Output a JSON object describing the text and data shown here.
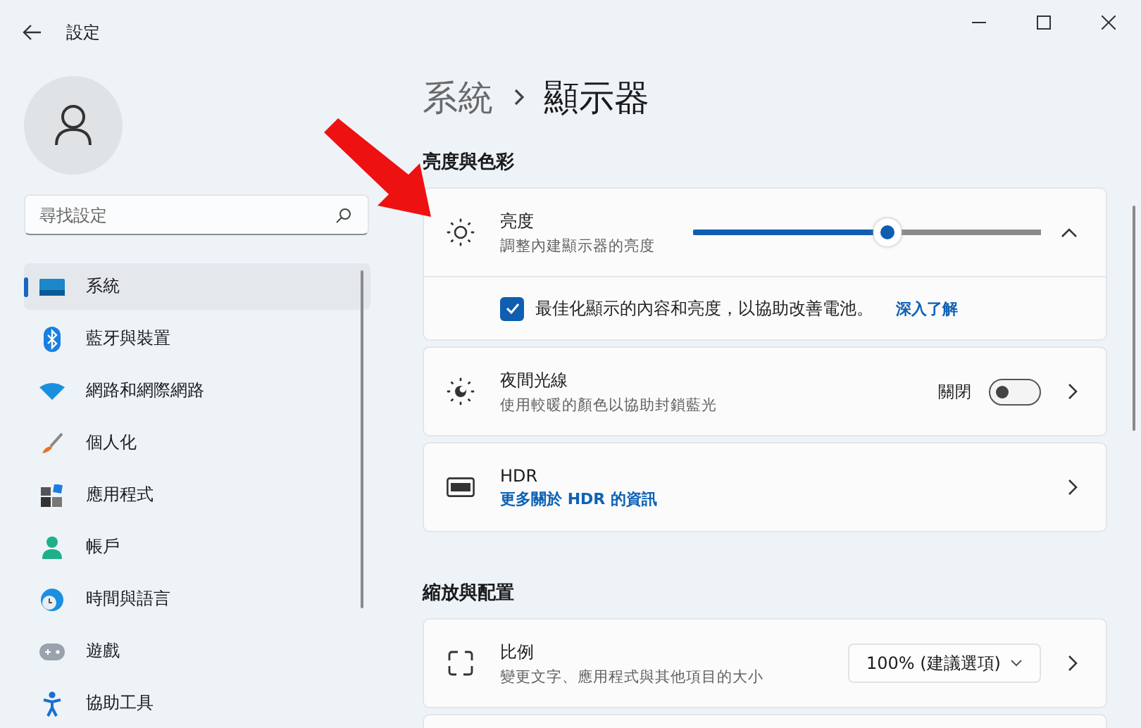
{
  "window": {
    "title": "設定"
  },
  "search": {
    "placeholder": "尋找設定"
  },
  "sidebar": {
    "items": [
      {
        "label": "系統",
        "selected": true
      },
      {
        "label": "藍牙與裝置",
        "selected": false
      },
      {
        "label": "網路和網際網路",
        "selected": false
      },
      {
        "label": "個人化",
        "selected": false
      },
      {
        "label": "應用程式",
        "selected": false
      },
      {
        "label": "帳戶",
        "selected": false
      },
      {
        "label": "時間與語言",
        "selected": false
      },
      {
        "label": "遊戲",
        "selected": false
      },
      {
        "label": "協助工具",
        "selected": false
      }
    ]
  },
  "breadcrumb": {
    "parent": "系統",
    "current": "顯示器"
  },
  "sections": [
    {
      "heading": "亮度與色彩",
      "cards": [
        {
          "kind": "slider",
          "title": "亮度",
          "subtitle": "調整內建顯示器的亮度",
          "level": 0.56,
          "expanded": true,
          "option": {
            "label": "最佳化顯示的內容和亮度，以協助改善電池。",
            "link": "深入了解",
            "checked": true
          }
        },
        {
          "kind": "toggle",
          "title": "夜間光線",
          "subtitle": "使用較暖的顏色以協助封鎖藍光",
          "state_label": "關閉",
          "on": false
        },
        {
          "kind": "link",
          "title": "HDR",
          "link": "更多關於 HDR 的資訊"
        }
      ]
    },
    {
      "heading": "縮放與配置",
      "cards": [
        {
          "kind": "dropdown",
          "title": "比例",
          "subtitle": "變更文字、應用程式與其他項目的大小",
          "value": "100% (建議選項)"
        },
        {
          "kind": "cut"
        }
      ]
    }
  ]
}
